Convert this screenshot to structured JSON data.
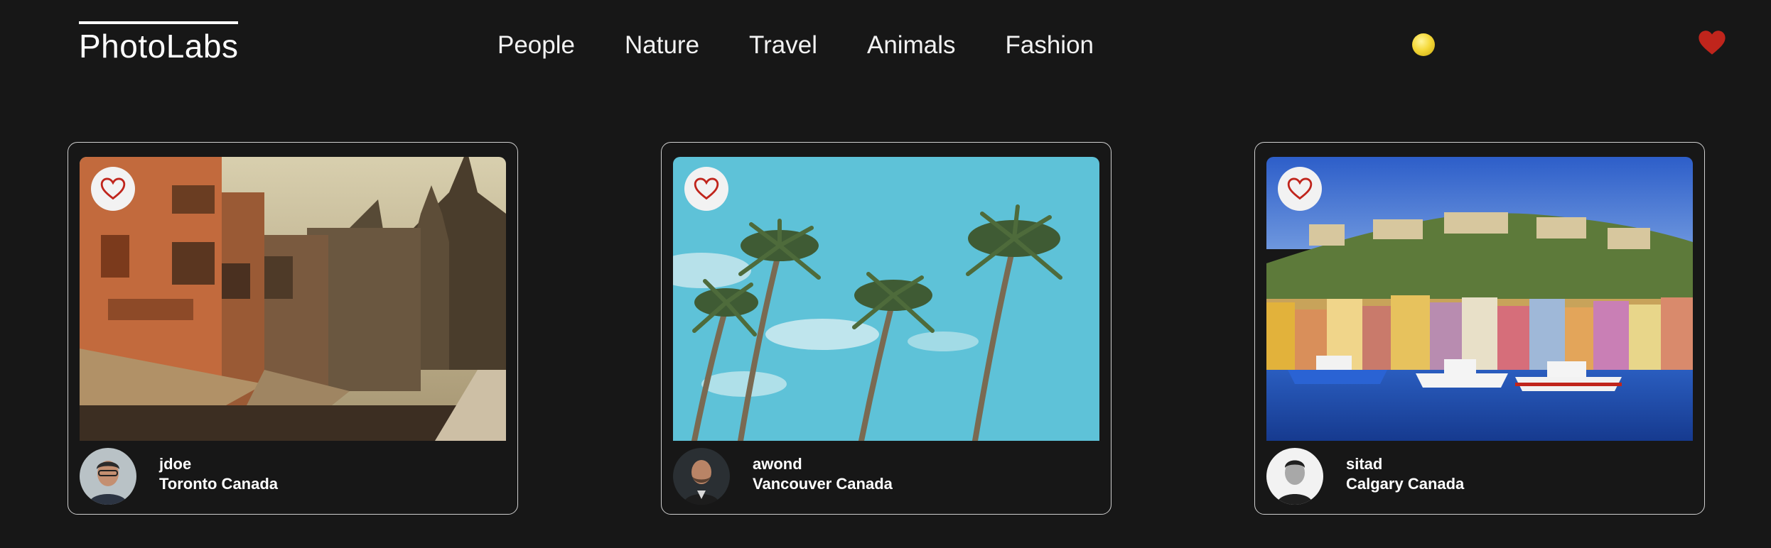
{
  "nav": {
    "logo": "PhotoLabs",
    "topics": [
      "People",
      "Nature",
      "Travel",
      "Animals",
      "Fashion"
    ]
  },
  "colors": {
    "background": "#171717",
    "heart": "#c0251c",
    "notification": "#f5d93a",
    "card_border": "#cfcfcf"
  },
  "photos": [
    {
      "username": "jdoe",
      "location": "Toronto Canada",
      "liked": false
    },
    {
      "username": "awond",
      "location": "Vancouver Canada",
      "liked": false
    },
    {
      "username": "sitad",
      "location": "Calgary Canada",
      "liked": false
    }
  ]
}
